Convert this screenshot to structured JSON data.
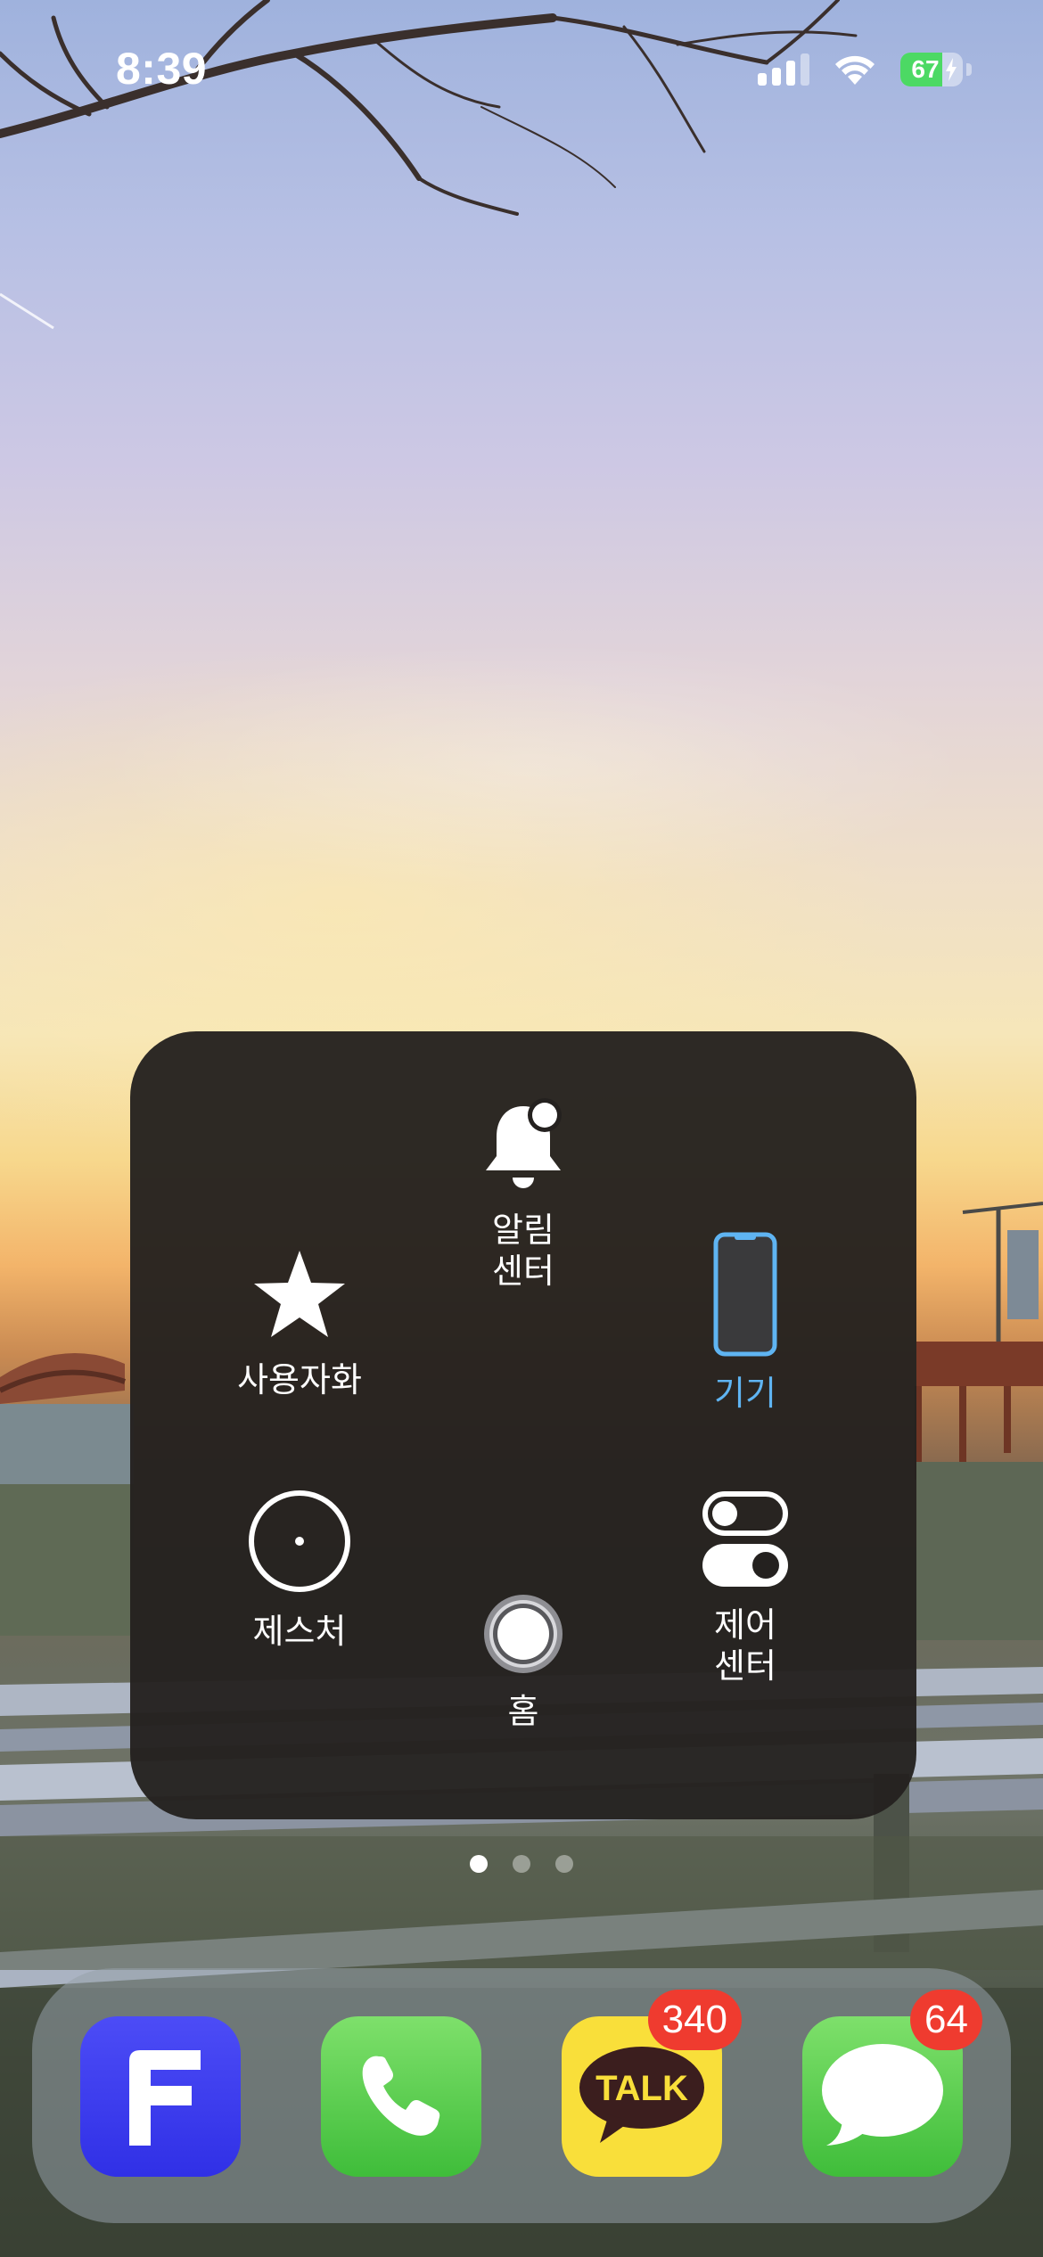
{
  "status_bar": {
    "time": "8:39",
    "battery_percent": 67,
    "battery_label": "67",
    "charging": true,
    "signal_bars_active": 3,
    "signal_bars_total": 4
  },
  "assistive_menu": {
    "items": [
      {
        "id": "notification-center",
        "label": "알림\n센터",
        "icon": "bell-icon"
      },
      {
        "id": "custom",
        "label": "사용자화",
        "icon": "star-icon"
      },
      {
        "id": "device",
        "label": "기기",
        "icon": "iphone-icon",
        "active": true
      },
      {
        "id": "gestures",
        "label": "제스처",
        "icon": "gesture-circle-icon"
      },
      {
        "id": "home",
        "label": "홈",
        "icon": "home-button-icon"
      },
      {
        "id": "control-center",
        "label": "제어\n센터",
        "icon": "toggles-icon"
      }
    ],
    "active_color": "#5fb4f2",
    "background": "#24211f"
  },
  "page_dots": {
    "count": 3,
    "current": 1
  },
  "dock": {
    "apps": [
      {
        "name": "flex",
        "icon": "flex-app-icon",
        "badge": null
      },
      {
        "name": "phone",
        "icon": "phone-app-icon",
        "badge": null
      },
      {
        "name": "kakaotalk",
        "icon": "kakaotalk-app-icon",
        "icon_text": "TALK",
        "badge": "340"
      },
      {
        "name": "messages",
        "icon": "messages-app-icon",
        "badge": "64"
      }
    ]
  }
}
